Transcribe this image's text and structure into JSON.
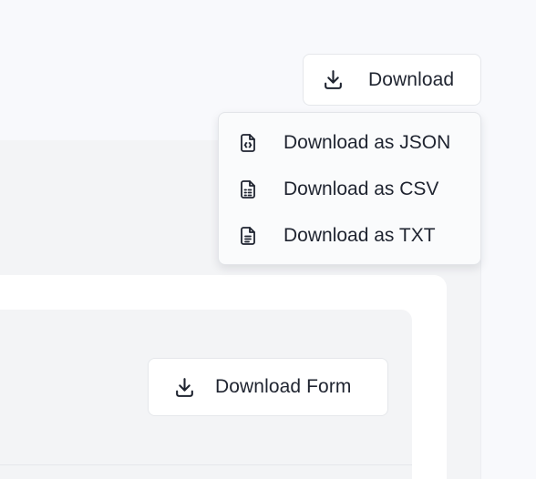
{
  "toolbar": {
    "download_button": {
      "label": "Download",
      "icon": "download-icon"
    }
  },
  "download_menu": {
    "items": [
      {
        "label": "Download as JSON",
        "icon": "file-json-icon"
      },
      {
        "label": "Download as CSV",
        "icon": "file-csv-icon"
      },
      {
        "label": "Download as TXT",
        "icon": "file-text-icon"
      }
    ]
  },
  "form_panel": {
    "download_form_button": {
      "label": "Download Form",
      "icon": "download-icon"
    }
  },
  "colors": {
    "page_background": "#f8f9fc",
    "panel_gray": "#f3f4f6",
    "panel_white": "#ffffff",
    "border": "#e5e7eb",
    "text": "#1f2430"
  }
}
